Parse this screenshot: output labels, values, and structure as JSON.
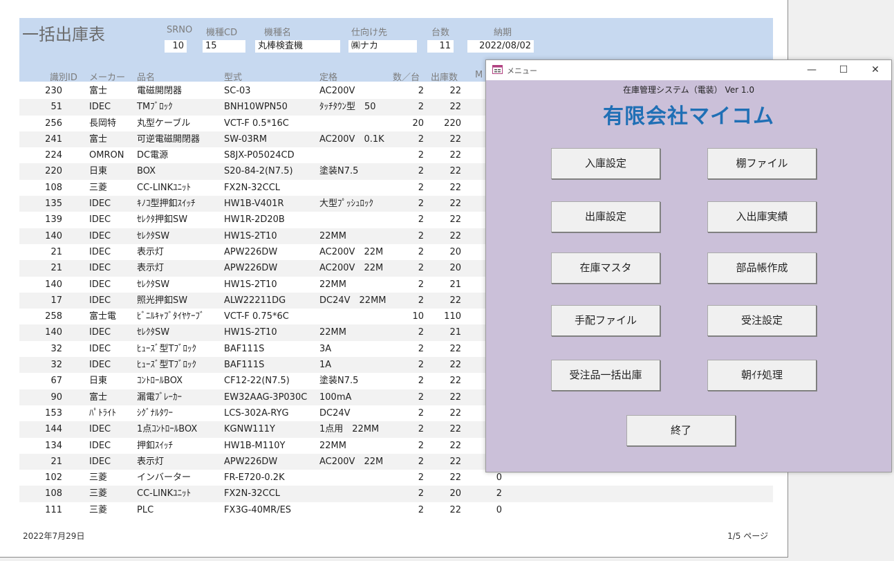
{
  "report": {
    "title": "一括出庫表",
    "header_labels": {
      "srno": "SRNO",
      "model_cd": "機種CD",
      "model_name": "機種名",
      "destination": "仕向け先",
      "units": "台数",
      "due": "納期"
    },
    "header_values": {
      "srno": "10",
      "model_cd": "15",
      "model_name": "丸棒検査機",
      "destination": "㈱ナカ",
      "units": "11",
      "due": "2022/08/02"
    },
    "columns": {
      "id": "識別ID",
      "maker": "メーカー",
      "part": "品名",
      "model": "型式",
      "rating": "定格",
      "qty_per": "数／台",
      "out_qty": "出庫数",
      "m": "M"
    },
    "rows": [
      {
        "id": "230",
        "maker": "富士",
        "part": "電磁開閉器",
        "model": "SC-03",
        "rating": "AC200V",
        "qty": "2",
        "out": "22",
        "m": ""
      },
      {
        "id": "51",
        "maker": "IDEC",
        "part": "TMﾌﾞﾛｯｸ",
        "model": "BNH10WPN50",
        "rating": "ﾀｯﾁﾀｳﾝ型　50",
        "qty": "2",
        "out": "22",
        "m": ""
      },
      {
        "id": "256",
        "maker": "長岡特",
        "part": "丸型ケーブル",
        "model": "VCT-F 0.5*16C",
        "rating": "",
        "qty": "20",
        "out": "220",
        "m": ""
      },
      {
        "id": "241",
        "maker": "富士",
        "part": "可逆電磁開閉器",
        "model": "SW-03RM",
        "rating": "AC200V　0.1K",
        "qty": "2",
        "out": "22",
        "m": ""
      },
      {
        "id": "224",
        "maker": "OMRON",
        "part": "DC電源",
        "model": "S8JX-P05024CD",
        "rating": "",
        "qty": "2",
        "out": "22",
        "m": ""
      },
      {
        "id": "220",
        "maker": "日東",
        "part": "BOX",
        "model": "S20-84-2(N7.5)",
        "rating": "塗装N7.5",
        "qty": "2",
        "out": "22",
        "m": ""
      },
      {
        "id": "108",
        "maker": "三菱",
        "part": "CC-LINKﾕﾆｯﾄ",
        "model": "FX2N-32CCL",
        "rating": "",
        "qty": "2",
        "out": "22",
        "m": ""
      },
      {
        "id": "135",
        "maker": "IDEC",
        "part": "ｷﾉｺ型押釦ｽｲｯﾁ",
        "model": "HW1B-V401R",
        "rating": "大型ﾌﾟｯｼｭﾛｯｸ",
        "qty": "2",
        "out": "22",
        "m": ""
      },
      {
        "id": "139",
        "maker": "IDEC",
        "part": "ｾﾚｸﾀ押釦SW",
        "model": "HW1R-2D20B",
        "rating": "",
        "qty": "2",
        "out": "22",
        "m": ""
      },
      {
        "id": "140",
        "maker": "IDEC",
        "part": "ｾﾚｸﾀSW",
        "model": "HW1S-2T10",
        "rating": "22MM",
        "qty": "2",
        "out": "22",
        "m": ""
      },
      {
        "id": "21",
        "maker": "IDEC",
        "part": "表示灯",
        "model": "APW226DW",
        "rating": "AC200V　22M",
        "qty": "2",
        "out": "20",
        "m": ""
      },
      {
        "id": "21",
        "maker": "IDEC",
        "part": "表示灯",
        "model": "APW226DW",
        "rating": "AC200V　22M",
        "qty": "2",
        "out": "20",
        "m": ""
      },
      {
        "id": "140",
        "maker": "IDEC",
        "part": "ｾﾚｸﾀSW",
        "model": "HW1S-2T10",
        "rating": "22MM",
        "qty": "2",
        "out": "21",
        "m": ""
      },
      {
        "id": "17",
        "maker": "IDEC",
        "part": "照光押釦SW",
        "model": "ALW22211DG",
        "rating": "DC24V　22MM",
        "qty": "2",
        "out": "22",
        "m": ""
      },
      {
        "id": "258",
        "maker": "富士電",
        "part": "ﾋﾞﾆﾙｷｬﾌﾞﾀｲﾔｹｰﾌﾞ",
        "model": "VCT-F 0.75*6C",
        "rating": "",
        "qty": "10",
        "out": "110",
        "m": ""
      },
      {
        "id": "140",
        "maker": "IDEC",
        "part": "ｾﾚｸﾀSW",
        "model": "HW1S-2T10",
        "rating": "22MM",
        "qty": "2",
        "out": "21",
        "m": ""
      },
      {
        "id": "32",
        "maker": "IDEC",
        "part": "ﾋｭｰｽﾞ型Tﾌﾞﾛｯｸ",
        "model": "BAF111S",
        "rating": "3A",
        "qty": "2",
        "out": "22",
        "m": ""
      },
      {
        "id": "32",
        "maker": "IDEC",
        "part": "ﾋｭｰｽﾞ型Tﾌﾞﾛｯｸ",
        "model": "BAF111S",
        "rating": "1A",
        "qty": "2",
        "out": "22",
        "m": ""
      },
      {
        "id": "67",
        "maker": "日東",
        "part": "ｺﾝﾄﾛｰﾙBOX",
        "model": "CF12-22(N7.5)",
        "rating": "塗装N7.5",
        "qty": "2",
        "out": "22",
        "m": ""
      },
      {
        "id": "90",
        "maker": "富士",
        "part": "漏電ﾌﾞﾚｰｶｰ",
        "model": "EW32AAG-3P030C",
        "rating": "100mA",
        "qty": "2",
        "out": "22",
        "m": ""
      },
      {
        "id": "153",
        "maker": "ﾊﾟﾄﾗｲﾄ",
        "part": "ｼｸﾞﾅﾙﾀﾜｰ",
        "model": "LCS-302A-RYG",
        "rating": "DC24V",
        "qty": "2",
        "out": "22",
        "m": ""
      },
      {
        "id": "144",
        "maker": "IDEC",
        "part": "1点ｺﾝﾄﾛｰﾙBOX",
        "model": "KGNW111Y",
        "rating": "1点用　22MM",
        "qty": "2",
        "out": "22",
        "m": ""
      },
      {
        "id": "134",
        "maker": "IDEC",
        "part": "押釦ｽｲｯﾁ",
        "model": "HW1B-M110Y",
        "rating": "22MM",
        "qty": "2",
        "out": "22",
        "m": ""
      },
      {
        "id": "21",
        "maker": "IDEC",
        "part": "表示灯",
        "model": "APW226DW",
        "rating": "AC200V　22M",
        "qty": "2",
        "out": "22",
        "m": ""
      },
      {
        "id": "102",
        "maker": "三菱",
        "part": "インバーター",
        "model": "FR-E720-0.2K",
        "rating": "",
        "qty": "2",
        "out": "22",
        "m": "0"
      },
      {
        "id": "108",
        "maker": "三菱",
        "part": "CC-LINKﾕﾆｯﾄ",
        "model": "FX2N-32CCL",
        "rating": "",
        "qty": "2",
        "out": "20",
        "m": "2"
      },
      {
        "id": "111",
        "maker": "三菱",
        "part": "PLC",
        "model": "FX3G-40MR/ES",
        "rating": "",
        "qty": "2",
        "out": "22",
        "m": "0"
      }
    ],
    "footer_date": "2022年7月29日",
    "footer_page": "1/5 ページ"
  },
  "menu": {
    "window_title": "メニュー",
    "subtitle": "在庫管理システム（電装） Ver 1.0",
    "company": "有限会社マイコム",
    "buttons": {
      "receiving": "入庫設定",
      "shelf_file": "棚ファイル",
      "shipping": "出庫設定",
      "io_results": "入出庫実績",
      "stock_master": "在庫マスタ",
      "parts_book": "部品帳作成",
      "order_file": "手配ファイル",
      "order_settings": "受注設定",
      "bulk_ship": "受注品一括出庫",
      "morning": "朝ｲﾁ処理",
      "exit": "終了"
    }
  }
}
